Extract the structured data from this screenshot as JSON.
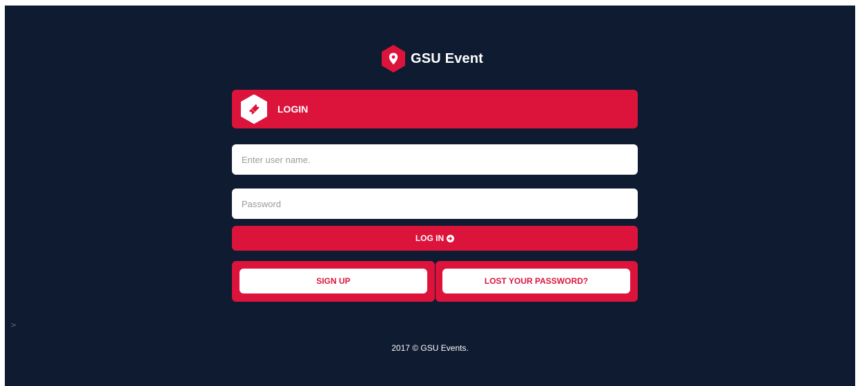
{
  "brand": {
    "title": "GSU Event",
    "logo_icon": "map-pin-icon",
    "accent_color": "#dc143c"
  },
  "login_panel": {
    "header_label": "LOGIN",
    "header_icon": "ticket-icon"
  },
  "form": {
    "username_placeholder": "Enter user name.",
    "username_value": "",
    "password_placeholder": "Password",
    "password_value": "",
    "login_button_label": "LOG IN",
    "login_button_icon": "arrow-circle-right-icon"
  },
  "actions": {
    "signup_label": "SIGN UP",
    "lost_password_label": "LOST YOUR PASSWORD?"
  },
  "stray_text": ">",
  "footer": {
    "text": "2017 © GSU Events."
  },
  "colors": {
    "background": "#0e1b31",
    "accent": "#dc143c",
    "text_light": "#ffffff"
  }
}
